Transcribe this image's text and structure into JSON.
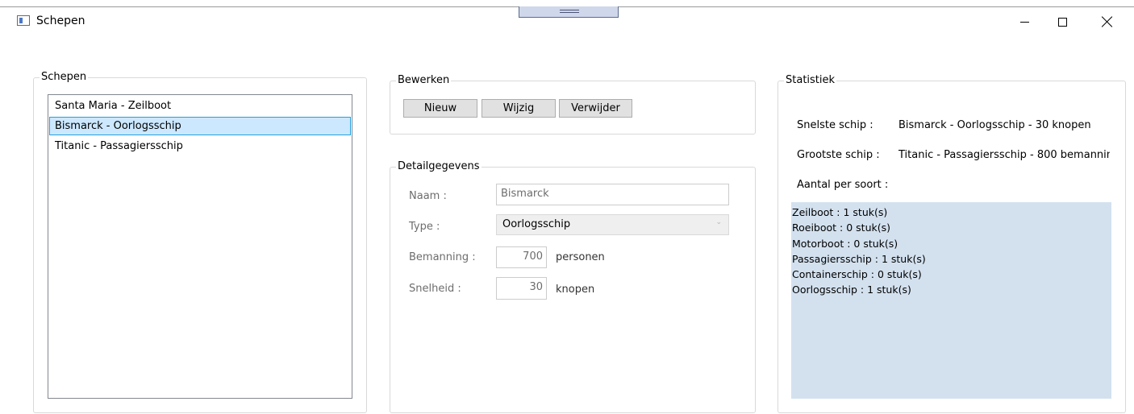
{
  "window": {
    "title": "Schepen",
    "controls": {
      "minimize": "minimize-icon",
      "maximize": "maximize-icon",
      "close": "close-icon"
    }
  },
  "ships_group": {
    "legend": "Schepen",
    "items": [
      "Santa Maria - Zeilboot",
      "Bismarck - Oorlogsschip",
      "Titanic - Passagiersschip"
    ],
    "selected_index": 1
  },
  "edit_group": {
    "legend": "Bewerken",
    "buttons": {
      "new": "Nieuw",
      "modify": "Wijzig",
      "delete": "Verwijder"
    }
  },
  "details_group": {
    "legend": "Detailgegevens",
    "name": {
      "label": "Naam :",
      "value": "Bismarck"
    },
    "type": {
      "label": "Type :",
      "value": "Oorlogsschip"
    },
    "crew": {
      "label": "Bemanning :",
      "value": "700",
      "unit": "personen"
    },
    "speed": {
      "label": "Snelheid :",
      "value": "30",
      "unit": "knopen"
    }
  },
  "stats_group": {
    "legend": "Statistiek",
    "fastest_label": "Snelste schip :",
    "fastest_value": "Bismarck - Oorlogsschip - 30 knopen",
    "largest_label": "Grootste schip :",
    "largest_value": "Titanic - Passagiersschip - 800 bemannin",
    "count_label": "Aantal per soort :",
    "counts": [
      "Zeilboot : 1 stuk(s)",
      "Roeiboot : 0 stuk(s)",
      "Motorboot : 0 stuk(s)",
      "Passagiersschip : 1 stuk(s)",
      "Containerschip : 0 stuk(s)",
      "Oorlogsschip : 1 stuk(s)"
    ]
  },
  "colors": {
    "selection_background": "#cce8ff",
    "selection_border": "#26a0da",
    "stats_background": "#d3e1ef",
    "button_background": "#e1e1e1"
  }
}
